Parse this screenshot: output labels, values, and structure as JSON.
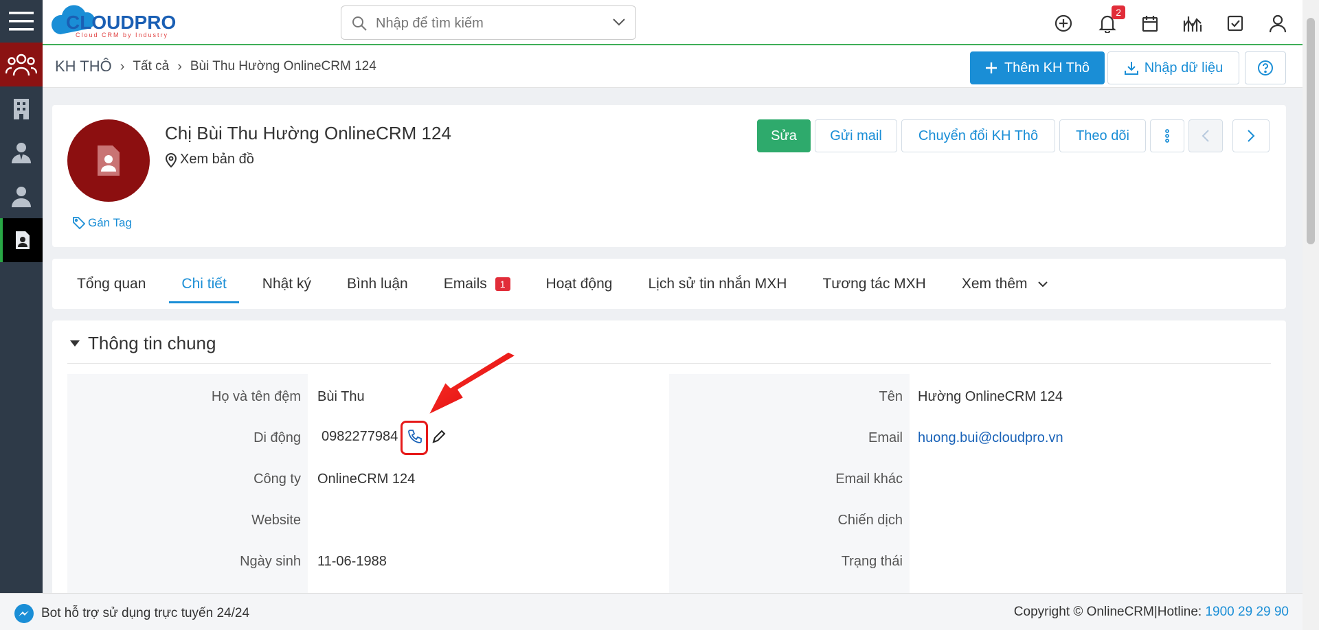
{
  "header": {
    "logo_text": "CLOUDPRO",
    "logo_sub": "Cloud CRM by Industry",
    "search_placeholder": "Nhập để tìm kiếm",
    "notification_count": "2"
  },
  "breadcrumb": {
    "module": "KH THÔ",
    "level1": "Tất cả",
    "level2": "Bùi Thu Hường OnlineCRM 124"
  },
  "toolbar": {
    "add_label": "Thêm KH Thô",
    "import_label": "Nhập dữ liệu"
  },
  "profile": {
    "name": "Chị Bùi Thu Hường OnlineCRM 124",
    "map_label": "Xem bản đồ",
    "tag_label": "Gán Tag",
    "actions": {
      "edit": "Sửa",
      "send_mail": "Gửi mail",
      "convert": "Chuyển đổi KH Thô",
      "follow": "Theo dõi"
    }
  },
  "tabs": [
    {
      "label": "Tổng quan"
    },
    {
      "label": "Chi tiết"
    },
    {
      "label": "Nhật ký"
    },
    {
      "label": "Bình luận"
    },
    {
      "label": "Emails",
      "badge": "1"
    },
    {
      "label": "Hoạt động"
    },
    {
      "label": "Lịch sử tin nhắn MXH"
    },
    {
      "label": "Tương tác MXH"
    },
    {
      "label": "Xem thêm"
    }
  ],
  "detail": {
    "section_title": "Thông tin chung",
    "left": [
      {
        "label": "Họ và tên đệm",
        "value": "Bùi Thu"
      },
      {
        "label": "Di động",
        "value": "0982277984"
      },
      {
        "label": "Công ty",
        "value": "OnlineCRM 124"
      },
      {
        "label": "Website",
        "value": ""
      },
      {
        "label": "Ngày sinh",
        "value": "11-06-1988"
      }
    ],
    "right": [
      {
        "label": "Tên",
        "value": "Hường OnlineCRM 124"
      },
      {
        "label": "Email",
        "value": "huong.bui@cloudpro.vn"
      },
      {
        "label": "Email khác",
        "value": ""
      },
      {
        "label": "Chiến dịch",
        "value": ""
      },
      {
        "label": "Trạng thái",
        "value": ""
      }
    ]
  },
  "footer": {
    "bot_text": "Bot hỗ trợ sử dụng trực tuyến 24/24",
    "copyright": "Copyright © OnlineCRM|Hotline: ",
    "hotline": "1900 29 29 90"
  },
  "colors": {
    "primary": "#1a8ed6",
    "sidebar": "#2e3a48",
    "avatar": "#8c0f10",
    "edit_button": "#2eaa6c",
    "highlight": "#e61a1a"
  }
}
